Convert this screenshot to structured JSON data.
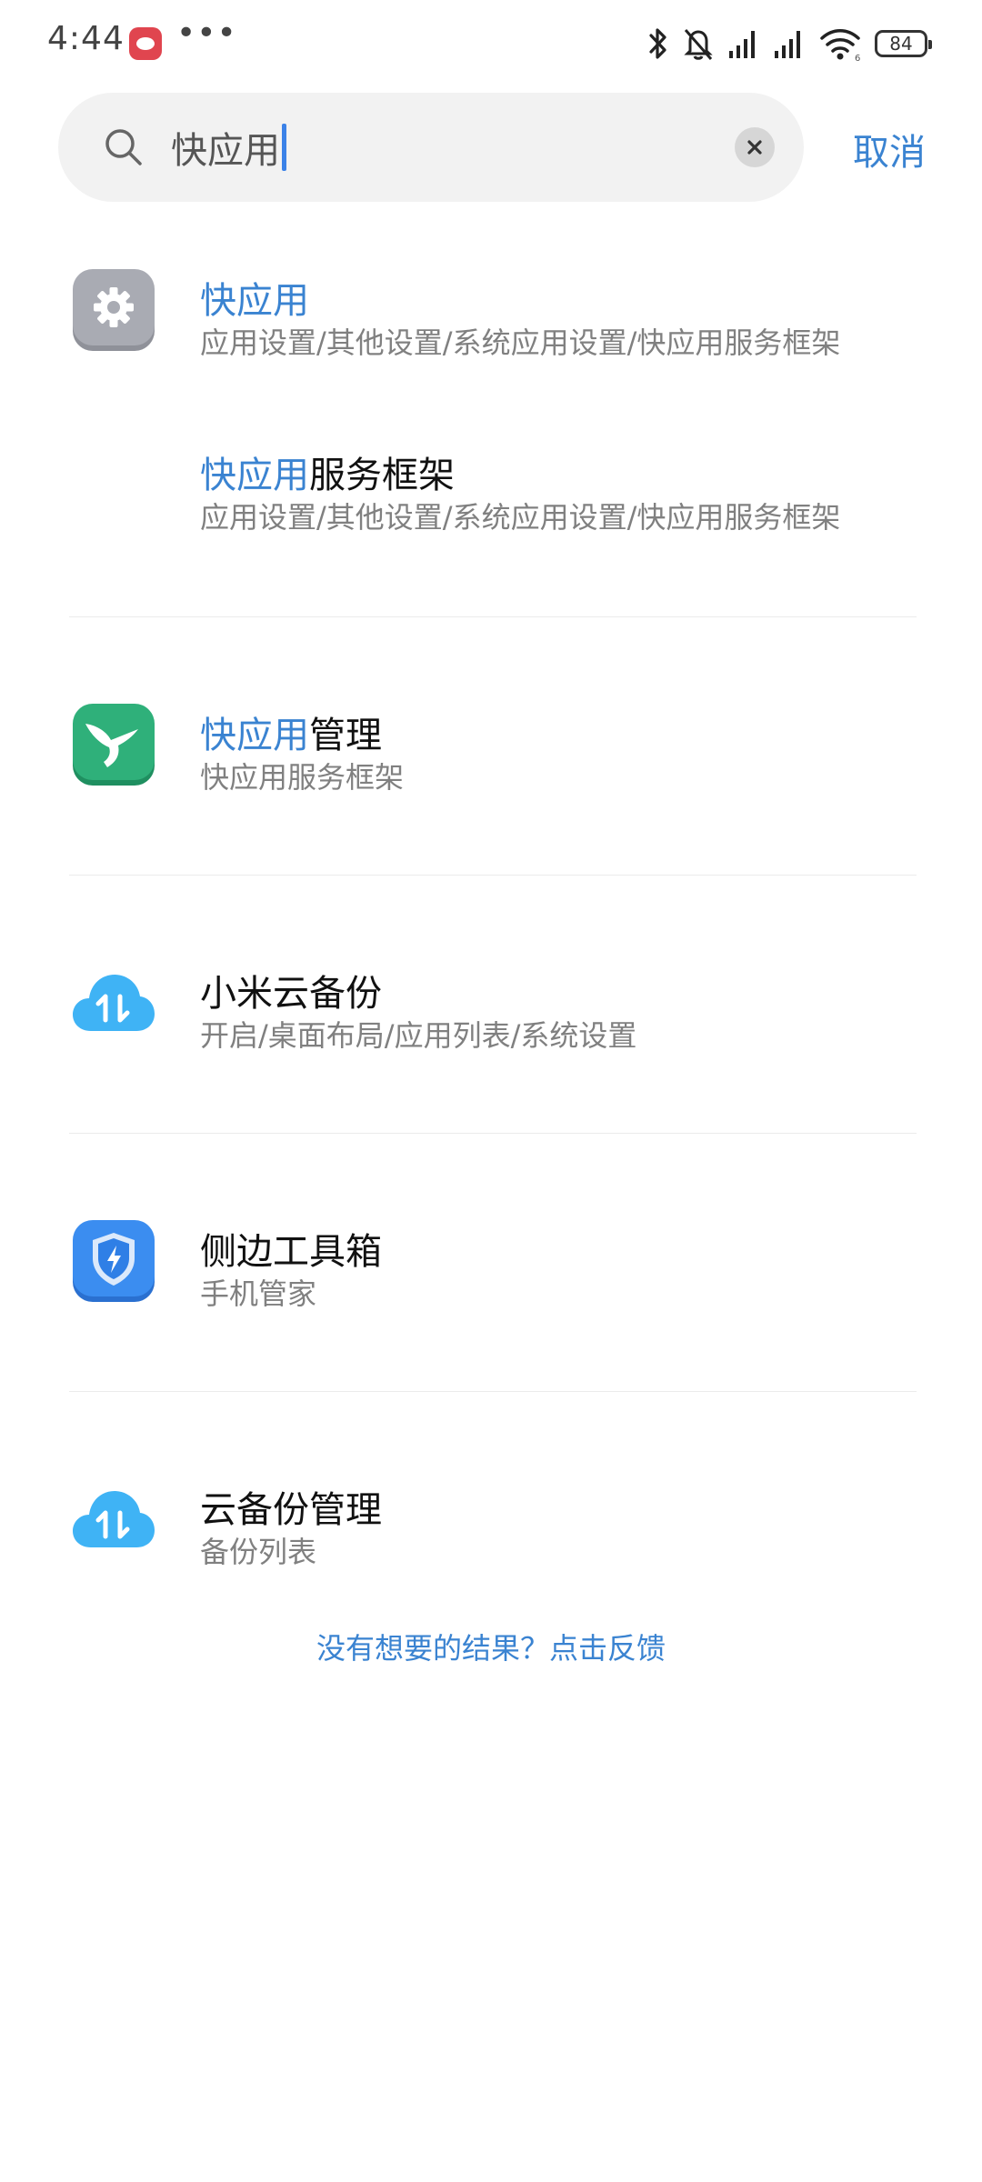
{
  "status_bar": {
    "time": "4:44",
    "more": "•••",
    "battery": "84",
    "network_badge": "6"
  },
  "search": {
    "query": "快应用",
    "cancel_label": "取消"
  },
  "results": [
    {
      "title_highlight": "快应用",
      "title_rest": "",
      "subtitle": "应用设置/其他设置/系统应用设置/快应用服务框架",
      "icon": "settings-gear-icon"
    },
    {
      "title_highlight": "快应用",
      "title_rest": "服务框架",
      "subtitle": "应用设置/其他设置/系统应用设置/快应用服务框架",
      "icon": ""
    },
    {
      "title_highlight": "快应用",
      "title_rest": "管理",
      "subtitle": "快应用服务框架",
      "icon": "hummingbird-icon"
    },
    {
      "title_highlight": "",
      "title_rest": "小米云备份",
      "subtitle": "开启/桌面布局/应用列表/系统设置",
      "icon": "cloud-sync-icon"
    },
    {
      "title_highlight": "",
      "title_rest": "侧边工具箱",
      "subtitle": "手机管家",
      "icon": "security-shield-icon"
    },
    {
      "title_highlight": "",
      "title_rest": "云备份管理",
      "subtitle": "备份列表",
      "icon": "cloud-sync-icon"
    }
  ],
  "feedback": "没有想要的结果？点击反馈",
  "colors": {
    "accent": "#3a83d1",
    "search_bg": "#f2f2f2",
    "caret": "#3b82e8",
    "cloud": "#3fb3f5",
    "shield_bg": "#3b8df0",
    "hummingbird_bg": "#2fb07a",
    "gear_bg": "#a9abb3"
  }
}
